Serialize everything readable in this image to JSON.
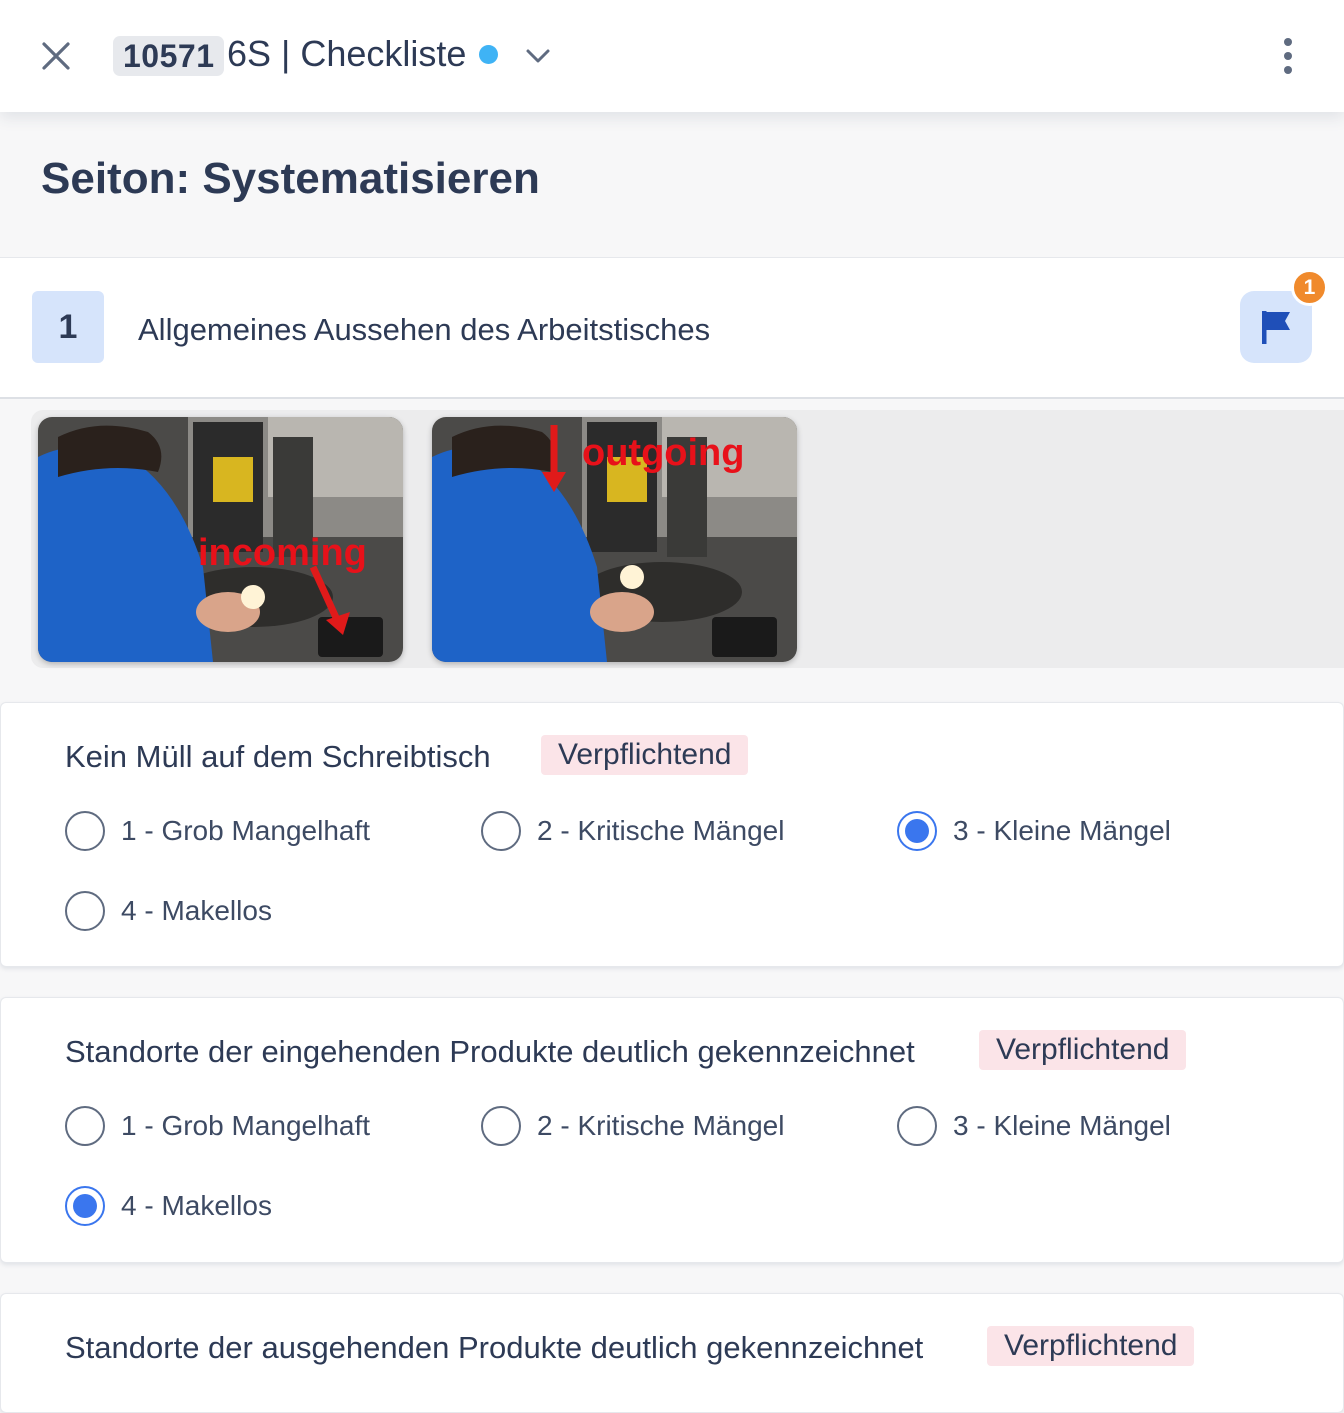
{
  "header": {
    "id": "10571",
    "title": "6S | Checkliste",
    "status_color": "#3fb3f5",
    "close_icon": "close-icon",
    "dropdown_icon": "chevron-down-icon",
    "menu_icon": "more-vertical-icon"
  },
  "section": {
    "title": "Seiton: Systematisieren"
  },
  "item": {
    "number": "1",
    "title": "Allgemeines Aussehen des Arbeitstisches",
    "flag_icon": "flag-icon",
    "flag_count": "1"
  },
  "images": [
    {
      "overlay_text": "incoming"
    },
    {
      "overlay_text": "outgoing"
    }
  ],
  "questions": [
    {
      "title": "Kein Müll auf dem Schreibtisch",
      "badge": "Verpflichtend",
      "options": [
        "1 - Grob Mangelhaft",
        "2 - Kritische Mängel",
        "3 - Kleine Mängel",
        "4 - Makellos"
      ],
      "selected": 2
    },
    {
      "title": "Standorte der eingehenden Produkte deutlich gekennzeichnet",
      "badge": "Verpflichtend",
      "options": [
        "1 - Grob Mangelhaft",
        "2 - Kritische Mängel",
        "3 - Kleine Mängel",
        "4 - Makellos"
      ],
      "selected": 3
    },
    {
      "title": "Standorte der ausgehenden Produkte deutlich gekennzeichnet",
      "badge": "Verpflichtend"
    }
  ],
  "colors": {
    "accent": "#3a76ee",
    "badge_bg": "#fbe4e8",
    "flag_count_bg": "#f08a2c",
    "chip_bg": "#d6e4fb"
  }
}
